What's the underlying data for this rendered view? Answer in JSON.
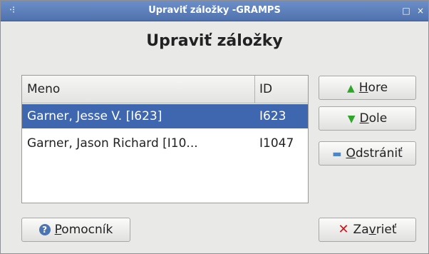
{
  "window": {
    "title": "Upraviť záložky -GRAMPS",
    "menu_glyph": "⋅⁝",
    "maximize_glyph": "□",
    "close_glyph": "×"
  },
  "dialog": {
    "heading": "Upraviť záložky"
  },
  "bookmarks": {
    "columns": [
      "Meno",
      "ID"
    ],
    "rows": [
      {
        "name": "Garner, Jesse V. [I623]",
        "id": "I623",
        "selected": true
      },
      {
        "name": "Garner, Jason Richard [I10...",
        "id": "I1047",
        "selected": false
      }
    ]
  },
  "buttons": {
    "up": {
      "mnemonic": "H",
      "rest": "ore",
      "icon": "arrow-up-icon"
    },
    "down": {
      "mnemonic": "D",
      "rest": "ole",
      "icon": "arrow-down-icon"
    },
    "remove": {
      "mnemonic": "O",
      "rest": "dstrániť",
      "icon": "remove-icon"
    },
    "help": {
      "mnemonic": "P",
      "rest": "omocník",
      "icon": "help-icon"
    },
    "close": {
      "pre": "Za",
      "mnemonic": "v",
      "rest": "rieť",
      "icon": "close-icon"
    }
  },
  "colors": {
    "titlebar": "#5a7dbb",
    "selection": "#3f67b0",
    "up_arrow": "#2fa62a",
    "close_icon": "#d4131b"
  }
}
